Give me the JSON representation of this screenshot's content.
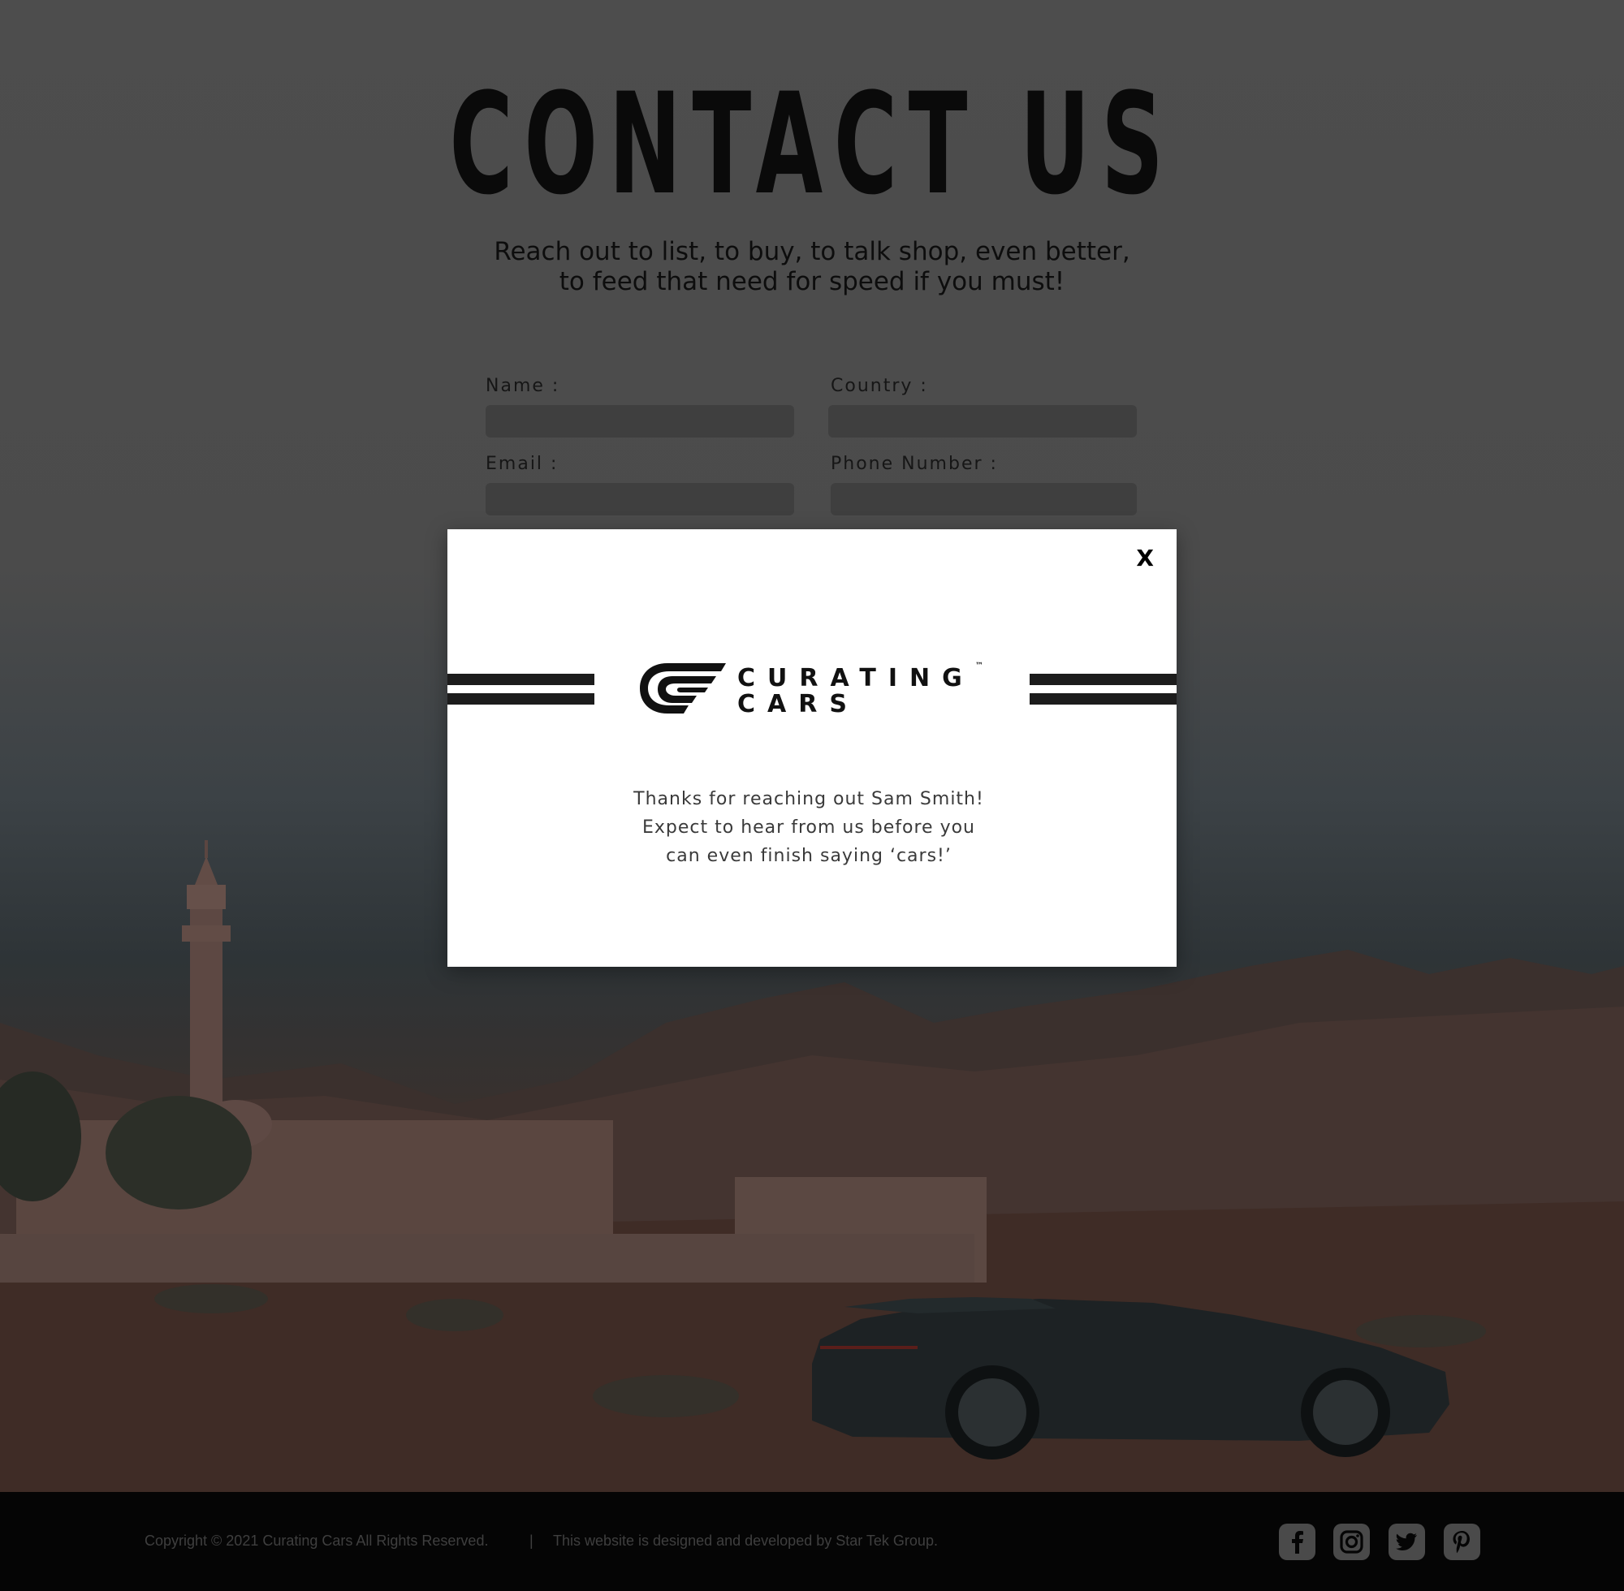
{
  "page": {
    "title": "CONTACT US",
    "subtitle_lines": [
      "Reach out to list, to buy, to talk shop, even better,",
      "to feed that need for speed if you must!"
    ]
  },
  "form": {
    "name_label": "Name :",
    "country_label": "Country :",
    "email_label": "Email :",
    "phone_label": "Phone Number :"
  },
  "modal": {
    "close_label": "X",
    "logo": {
      "line1": "CURATING",
      "line2": "CARS",
      "trademark": "™"
    },
    "message_lines": [
      "Thanks for reaching out Sam Smith!",
      "Expect to hear from us before you",
      "can even finish saying ‘cars!’"
    ]
  },
  "footer": {
    "copyright": "Copyright © 2021 Curating Cars All Rights Reserved.",
    "separator": "|",
    "credit": "This website is designed and developed by Star Tek Group.",
    "social_icons": [
      "facebook-icon",
      "instagram-icon",
      "twitter-icon",
      "pinterest-icon"
    ]
  },
  "colors": {
    "overlay": "#4b4b4b",
    "modal_bg": "#ffffff",
    "footer_bg": "#050505",
    "icon_bg": "#4a4a4a"
  }
}
